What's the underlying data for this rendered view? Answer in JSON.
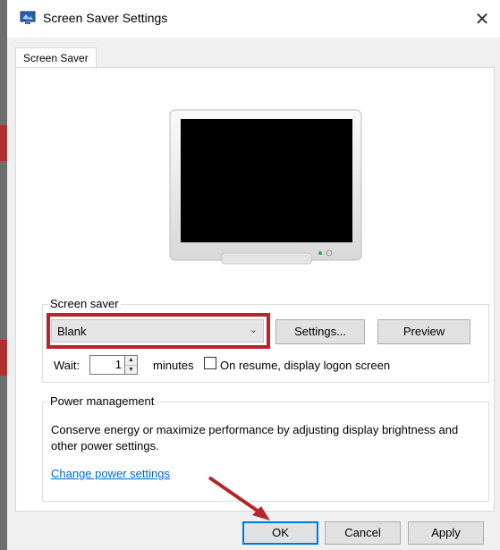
{
  "window": {
    "title": "Screen Saver Settings",
    "close_symbol": "✕",
    "icon": "screen-saver-app-icon"
  },
  "tabs": [
    {
      "label": "Screen Saver",
      "selected": true
    }
  ],
  "screen_saver": {
    "group_label": "Screen saver",
    "selected": "Blank",
    "settings_label": "Settings...",
    "preview_label": "Preview",
    "wait_label": "Wait:",
    "wait_value": "1",
    "minutes_label": "minutes",
    "resume_label": "On resume, display logon screen",
    "resume_checked": false
  },
  "power": {
    "group_label": "Power management",
    "description": "Conserve energy or maximize performance by adjusting display brightness and other power settings.",
    "link": "Change power settings"
  },
  "buttons": {
    "ok": "OK",
    "cancel": "Cancel",
    "apply": "Apply"
  },
  "colors": {
    "highlight": "#b3262b",
    "arrow": "#b3262b",
    "link": "#0066cc",
    "focus": "#0078d7"
  }
}
